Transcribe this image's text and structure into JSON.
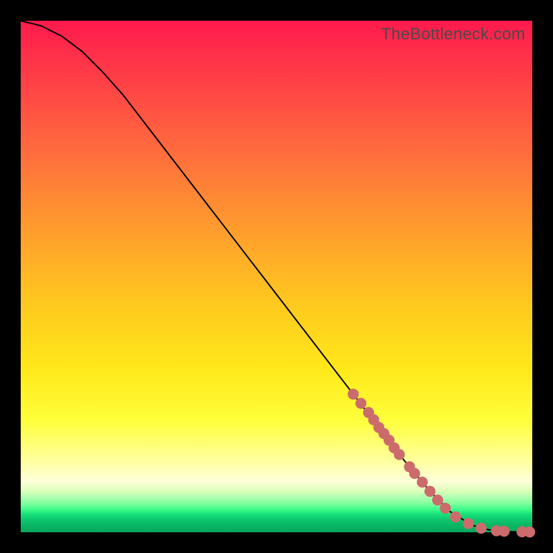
{
  "watermark": "TheBottleneck.com",
  "colors": {
    "dot": "#cc6b6b",
    "curve": "#000000"
  },
  "chart_data": {
    "type": "line",
    "title": "",
    "xlabel": "",
    "ylabel": "",
    "xlim": [
      0,
      100
    ],
    "ylim": [
      0,
      100
    ],
    "grid": false,
    "series": [
      {
        "name": "curve",
        "x": [
          0,
          4,
          8,
          12,
          16,
          20,
          25,
          30,
          35,
          40,
          45,
          50,
          55,
          60,
          65,
          70,
          75,
          80,
          84,
          88,
          90,
          92,
          94,
          96,
          98,
          100
        ],
        "y": [
          100,
          99,
          97,
          94,
          90,
          85.5,
          79,
          72.5,
          66,
          59.5,
          53,
          46.5,
          40,
          33.5,
          27,
          20.5,
          14,
          8,
          4,
          1.5,
          0.8,
          0.4,
          0.2,
          0.1,
          0.05,
          0.05
        ]
      }
    ],
    "points": [
      {
        "x": 65.0,
        "y": 27.0
      },
      {
        "x": 66.5,
        "y": 25.2
      },
      {
        "x": 68.0,
        "y": 23.4
      },
      {
        "x": 69.0,
        "y": 22.0
      },
      {
        "x": 70.0,
        "y": 20.5
      },
      {
        "x": 71.0,
        "y": 19.3
      },
      {
        "x": 72.0,
        "y": 18.0
      },
      {
        "x": 73.0,
        "y": 16.5
      },
      {
        "x": 74.0,
        "y": 15.2
      },
      {
        "x": 76.0,
        "y": 12.8
      },
      {
        "x": 77.0,
        "y": 11.5
      },
      {
        "x": 78.5,
        "y": 9.8
      },
      {
        "x": 80.0,
        "y": 8.0
      },
      {
        "x": 81.5,
        "y": 6.3
      },
      {
        "x": 83.0,
        "y": 4.7
      },
      {
        "x": 85.0,
        "y": 3.0
      },
      {
        "x": 87.5,
        "y": 1.7
      },
      {
        "x": 90.0,
        "y": 0.8
      },
      {
        "x": 93.0,
        "y": 0.3
      },
      {
        "x": 94.5,
        "y": 0.2
      },
      {
        "x": 98.0,
        "y": 0.1
      },
      {
        "x": 99.5,
        "y": 0.05
      }
    ]
  }
}
